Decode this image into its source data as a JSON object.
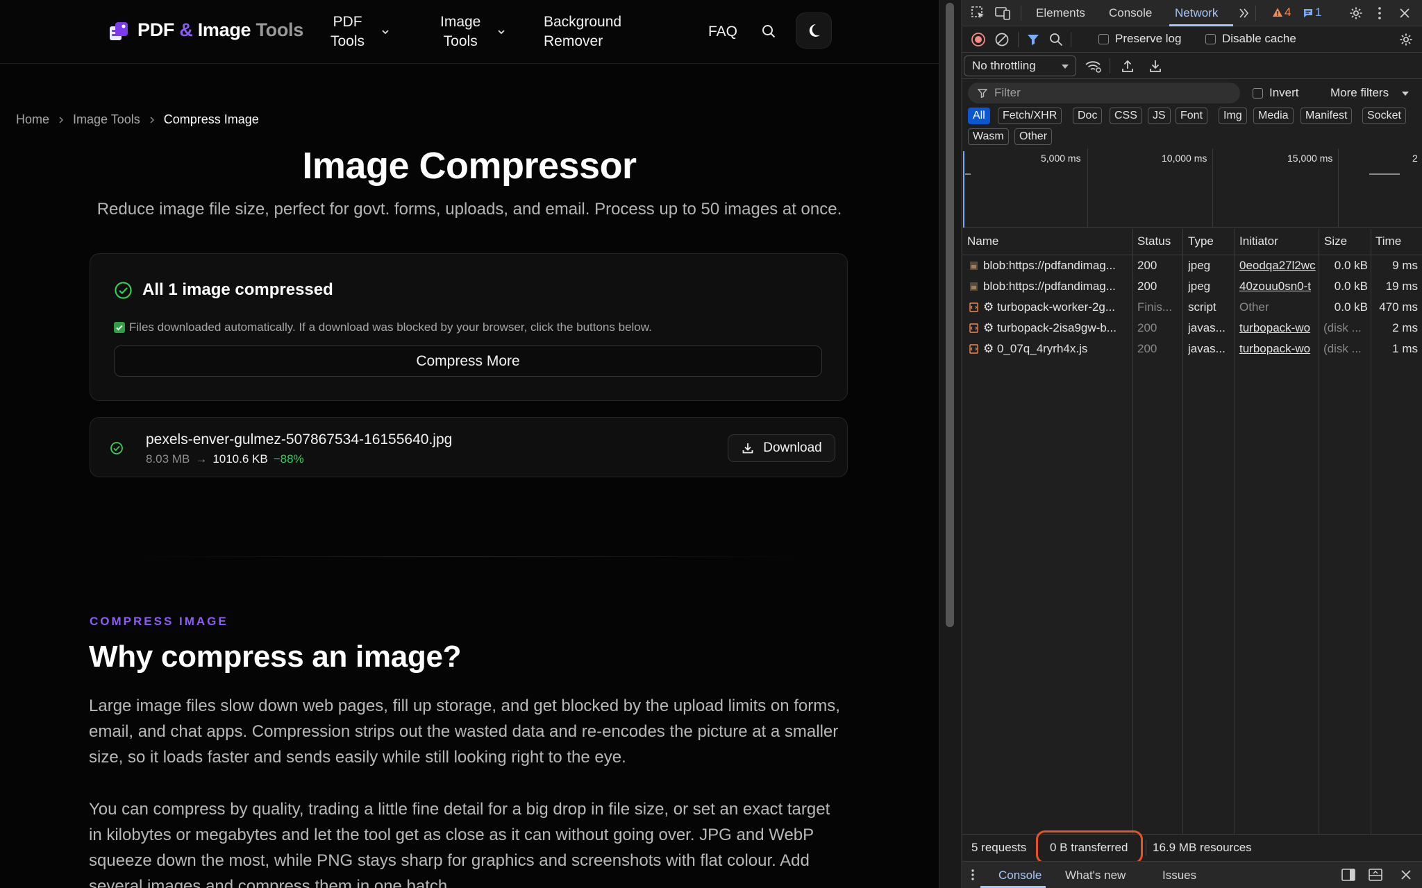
{
  "site": {
    "logo": {
      "part1": "PDF",
      "amp": "&",
      "part2": "Image",
      "part3": "Tools"
    },
    "nav": {
      "pdf_tools": "PDF\nTools",
      "image_tools": "Image\nTools",
      "bg_remover": "Background\nRemover",
      "faq": "FAQ"
    },
    "breadcrumb": {
      "home": "Home",
      "image_tools": "Image Tools",
      "current": "Compress Image"
    },
    "title": "Image Compressor",
    "subtitle": "Reduce image file size, perfect for govt. forms, uploads, and email. Process up to 50 images at once.",
    "result": {
      "heading": "All 1 image compressed",
      "note": "Files downloaded automatically. If a download was blocked by your browser, click the buttons below.",
      "compress_more": "Compress More"
    },
    "file": {
      "name": "pexels-enver-gulmez-507867534-16155640.jpg",
      "original_size": "8.03 MB",
      "arrow": "→",
      "new_size": "1010.6 KB",
      "reduction": "−88%",
      "download": "Download"
    },
    "section": {
      "eyebrow": "COMPRESS IMAGE",
      "title": "Why compress an image?",
      "para1": "Large image files slow down web pages, fill up storage, and get blocked by the upload limits on forms, email, and chat apps. Compression strips out the wasted data and re-encodes the picture at a smaller size, so it loads faster and sends easily while still looking right to the eye.",
      "para2": "You can compress by quality, trading a little fine detail for a big drop in file size, or set an exact target in kilobytes or megabytes and let the tool get as close as it can without going over. JPG and WebP squeeze down the most, while PNG stays sharp for graphics and screenshots with flat colour. Add several images and compress them in one batch."
    },
    "colors": {
      "accent": "#8b5cf6",
      "success": "#34d058"
    }
  },
  "devtools": {
    "tabs": {
      "elements": "Elements",
      "console": "Console",
      "network": "Network"
    },
    "badges": {
      "warnings": "4",
      "messages": "1"
    },
    "toolbar": {
      "preserve_log": "Preserve log",
      "disable_cache": "Disable cache",
      "throttling": "No throttling"
    },
    "filter": {
      "placeholder": "Filter",
      "invert": "Invert",
      "more_filters": "More filters"
    },
    "type_filters": [
      "All",
      "Fetch/XHR",
      "Doc",
      "CSS",
      "JS",
      "Font",
      "Img",
      "Media",
      "Manifest",
      "Socket",
      "Wasm",
      "Other"
    ],
    "timeline_labels": [
      "5,000 ms",
      "10,000 ms",
      "15,000 ms",
      "2"
    ],
    "columns": {
      "name": "Name",
      "status": "Status",
      "type": "Type",
      "initiator": "Initiator",
      "size": "Size",
      "time": "Time"
    },
    "rows": [
      {
        "name": "blob:https://pdfandimag...",
        "status": "200",
        "type": "jpeg",
        "initiator": "0eodqa27l2wc",
        "size": "0.0 kB",
        "time": "9 ms"
      },
      {
        "name": "blob:https://pdfandimag...",
        "status": "200",
        "type": "jpeg",
        "initiator": "40zouu0sn0-t",
        "size": "0.0 kB",
        "time": "19 ms"
      },
      {
        "name": "⚙ turbopack-worker-2g...",
        "status": "Finis...",
        "type": "script",
        "initiator": "Other",
        "size": "0.0 kB",
        "time": "470 ms"
      },
      {
        "name": "⚙ turbopack-2isa9gw-b...",
        "status": "200",
        "type": "javas...",
        "initiator": "turbopack-wo",
        "size": "(disk ...",
        "time": "2 ms"
      },
      {
        "name": "⚙ 0_07q_4ryrh4x.js",
        "status": "200",
        "type": "javas...",
        "initiator": "turbopack-wo",
        "size": "(disk ...",
        "time": "1 ms"
      }
    ],
    "status_bar": {
      "requests": "5 requests",
      "transferred": "0 B transferred",
      "resources": "16.9 MB resources"
    },
    "drawer": {
      "console": "Console",
      "whats_new": "What's new",
      "issues": "Issues"
    }
  }
}
